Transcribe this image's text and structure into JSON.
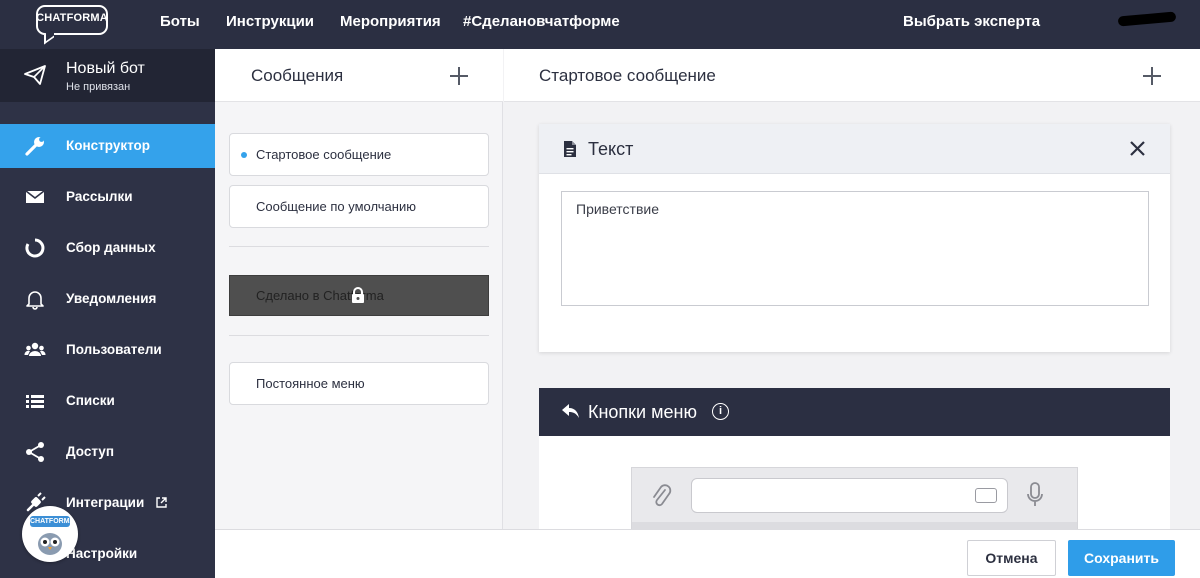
{
  "header": {
    "logo_text": "CHATFORMA",
    "nav": [
      "Боты",
      "Инструкции",
      "Мероприятия",
      "#Сделановчатформе"
    ],
    "expert_link": "Выбрать эксперта"
  },
  "bot": {
    "name": "Новый бот",
    "status": "Не привязан"
  },
  "sidebar": {
    "items": [
      {
        "label": "Конструктор",
        "icon": "wrench-icon",
        "active": true
      },
      {
        "label": "Рассылки",
        "icon": "envelope-icon"
      },
      {
        "label": "Сбор данных",
        "icon": "circle-progress-icon"
      },
      {
        "label": "Уведомления",
        "icon": "bell-icon"
      },
      {
        "label": "Пользователи",
        "icon": "users-icon"
      },
      {
        "label": "Списки",
        "icon": "list-icon"
      },
      {
        "label": "Доступ",
        "icon": "share-icon"
      },
      {
        "label": "Интеграции",
        "icon": "plug-icon"
      },
      {
        "label": "Настройки",
        "icon": "gear-icon"
      }
    ],
    "mascot_label": "CHATFORMA"
  },
  "messages": {
    "title": "Сообщения",
    "items": [
      "Стартовое сообщение",
      "Сообщение по умолчанию"
    ],
    "locked_item": "Сделано в Chatforma",
    "persistent_menu": "Постоянное меню"
  },
  "editor": {
    "title": "Стартовое сообщение",
    "text_block": {
      "title": "Текст",
      "value": "Приветствие"
    },
    "menu_buttons": {
      "title": "Кнопки меню",
      "info": "i"
    }
  },
  "footer": {
    "cancel": "Отмена",
    "save": "Сохранить"
  },
  "colors": {
    "topbar": "#2b2f42",
    "sidebar": "#2e3246",
    "accent": "#34a2eb"
  }
}
